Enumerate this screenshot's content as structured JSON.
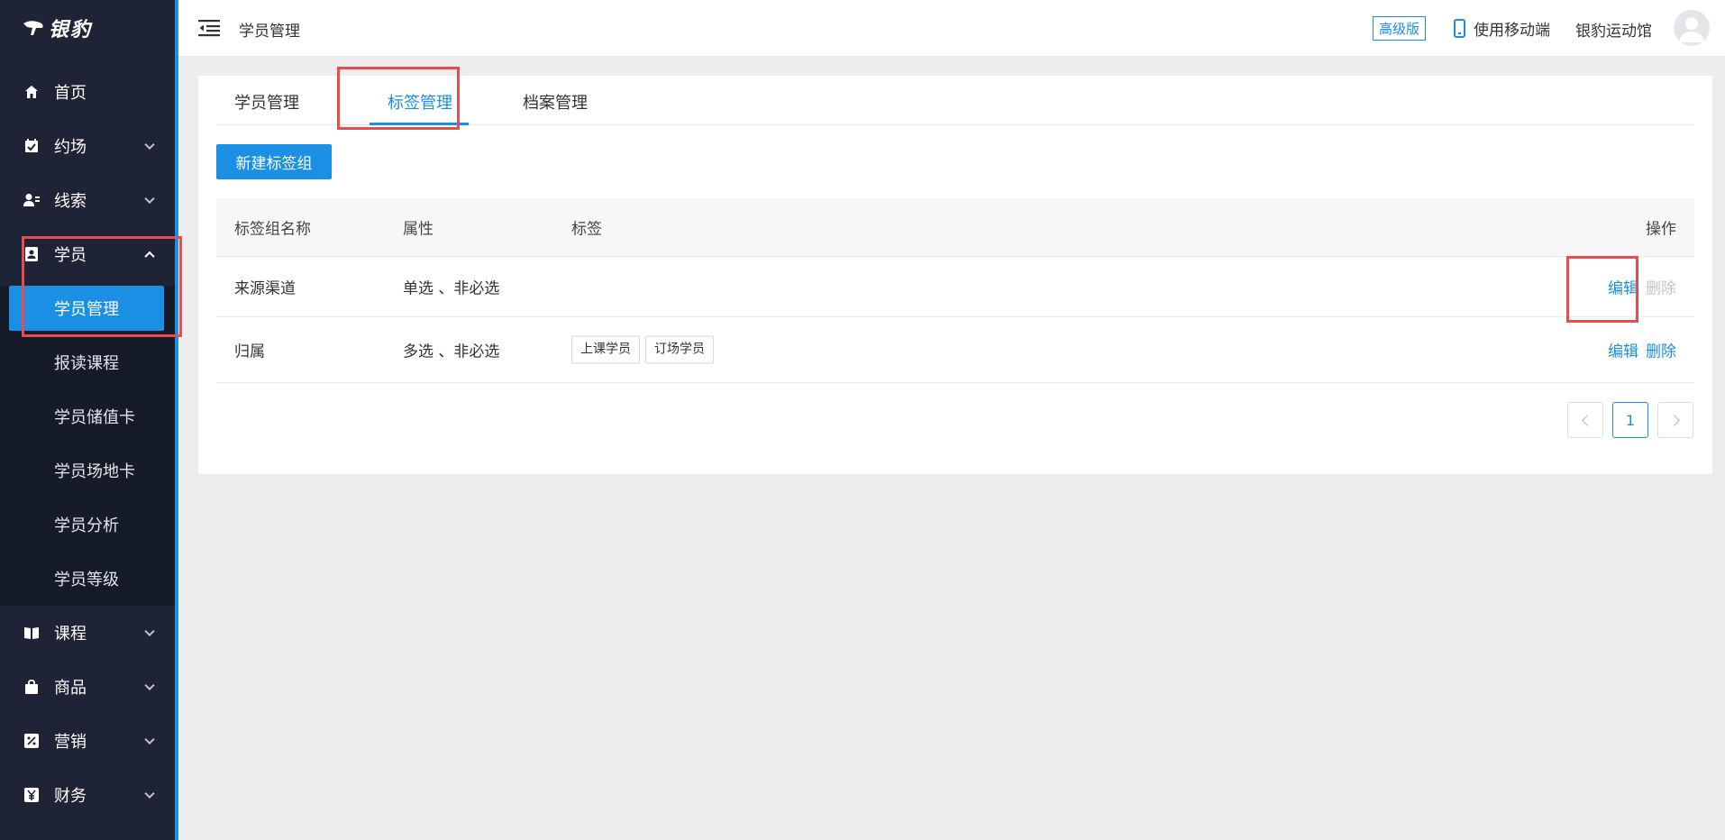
{
  "brand": {
    "name": "银豹"
  },
  "sidebar": {
    "items": [
      {
        "label": "首页",
        "icon": "home-icon",
        "expandable": false
      },
      {
        "label": "约场",
        "icon": "calendar-check-icon",
        "expandable": true
      },
      {
        "label": "线索",
        "icon": "user-lead-icon",
        "expandable": true
      },
      {
        "label": "学员",
        "icon": "student-card-icon",
        "expandable": true,
        "expanded": true
      },
      {
        "label": "课程",
        "icon": "book-icon",
        "expandable": true
      },
      {
        "label": "商品",
        "icon": "bag-icon",
        "expandable": true
      },
      {
        "label": "营销",
        "icon": "percent-icon",
        "expandable": true
      },
      {
        "label": "财务",
        "icon": "yen-icon",
        "expandable": true
      }
    ],
    "student_sub": [
      {
        "label": "学员管理",
        "active": true
      },
      {
        "label": "报读课程"
      },
      {
        "label": "学员储值卡"
      },
      {
        "label": "学员场地卡"
      },
      {
        "label": "学员分析"
      },
      {
        "label": "学员等级"
      }
    ]
  },
  "header": {
    "title": "学员管理",
    "badge": "高级版",
    "mobile_label": "使用移动端",
    "venue": "银豹运动馆"
  },
  "tabs": [
    {
      "label": "学员管理"
    },
    {
      "label": "标签管理",
      "active": true
    },
    {
      "label": "档案管理"
    }
  ],
  "new_button": "新建标签组",
  "table": {
    "headers": {
      "name": "标签组名称",
      "attr": "属性",
      "tags": "标签",
      "ops": "操作"
    },
    "rows": [
      {
        "name": "来源渠道",
        "attr": "单选 、非必选",
        "tags": [],
        "edit": "编辑",
        "delete": "删除",
        "delete_disabled": true
      },
      {
        "name": "归属",
        "attr": "多选 、非必选",
        "tags": [
          "上课学员",
          "订场学员"
        ],
        "edit": "编辑",
        "delete": "删除",
        "delete_disabled": false
      }
    ]
  },
  "pagination": {
    "current": "1"
  },
  "colors": {
    "accent": "#1a8fe3",
    "sidebar_bg": "#1e2435",
    "highlight": "#e84c4f"
  }
}
